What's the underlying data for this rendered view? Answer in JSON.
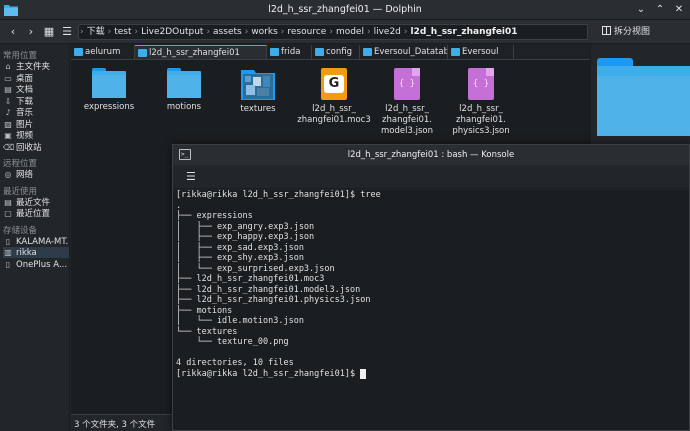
{
  "dolphin": {
    "window_title": "l2d_h_ssr_zhangfei01 — Dolphin",
    "breadcrumb": [
      "下载",
      "test",
      "Live2DOutput",
      "assets",
      "works",
      "resource",
      "model",
      "live2d",
      "l2d_h_ssr_zhangfei01"
    ],
    "split_view_label": "拆分视图",
    "sidebar": {
      "sections": [
        {
          "header": "常用位置",
          "items": [
            {
              "label": "主文件夹",
              "icon": "home-icon"
            },
            {
              "label": "桌面",
              "icon": "desktop-icon"
            },
            {
              "label": "文档",
              "icon": "documents-icon"
            },
            {
              "label": "下载",
              "icon": "downloads-icon"
            },
            {
              "label": "音乐",
              "icon": "music-icon"
            },
            {
              "label": "图片",
              "icon": "pictures-icon"
            },
            {
              "label": "视频",
              "icon": "videos-icon"
            },
            {
              "label": "回收站",
              "icon": "trash-icon"
            }
          ]
        },
        {
          "header": "远程位置",
          "items": [
            {
              "label": "网络",
              "icon": "network-icon"
            }
          ]
        },
        {
          "header": "最近使用",
          "items": [
            {
              "label": "最近文件",
              "icon": "recent-files-icon"
            },
            {
              "label": "最近位置",
              "icon": "recent-locations-icon"
            }
          ]
        },
        {
          "header": "存储设备",
          "items": [
            {
              "label": "KALAMA-MT...",
              "icon": "phone-icon"
            },
            {
              "label": "rikka",
              "icon": "drive-icon"
            },
            {
              "label": "OnePlus A...",
              "icon": "phone-icon"
            }
          ]
        }
      ]
    },
    "tabs": [
      "aelurum",
      "l2d_h_ssr_zhangfei01",
      "frida",
      "config",
      "Eversoul_Datatable",
      "Eversoul"
    ],
    "files": [
      {
        "name": "expressions",
        "type": "folder"
      },
      {
        "name": "motions",
        "type": "folder"
      },
      {
        "name": "textures",
        "type": "texture-folder"
      },
      {
        "name": "l2d_h_ssr_\nzhangfei01.moc3",
        "type": "moc3"
      },
      {
        "name": "l2d_h_ssr_\nzhangfei01.\nmodel3.json",
        "type": "json"
      },
      {
        "name": "l2d_h_ssr_\nzhangfei01.\nphysics3.json",
        "type": "json"
      }
    ],
    "status": "3 个文件夹, 3 个文件"
  },
  "konsole": {
    "window_title": "l2d_h_ssr_zhangfei01 : bash — Konsole",
    "terminal_lines": [
      "[rikka@rikka l2d_h_ssr_zhangfei01]$ tree",
      ".",
      "├── expressions",
      "│   ├── exp_angry.exp3.json",
      "│   ├── exp_happy.exp3.json",
      "│   ├── exp_sad.exp3.json",
      "│   ├── exp_shy.exp3.json",
      "│   └── exp_surprised.exp3.json",
      "├── l2d_h_ssr_zhangfei01.moc3",
      "├── l2d_h_ssr_zhangfei01.model3.json",
      "├── l2d_h_ssr_zhangfei01.physics3.json",
      "├── motions",
      "│   └── idle.motion3.json",
      "└── textures",
      "    └── texture_00.png",
      "",
      "4 directories, 10 files"
    ],
    "prompt": "[rikka@rikka l2d_h_ssr_zhangfei01]$ "
  }
}
